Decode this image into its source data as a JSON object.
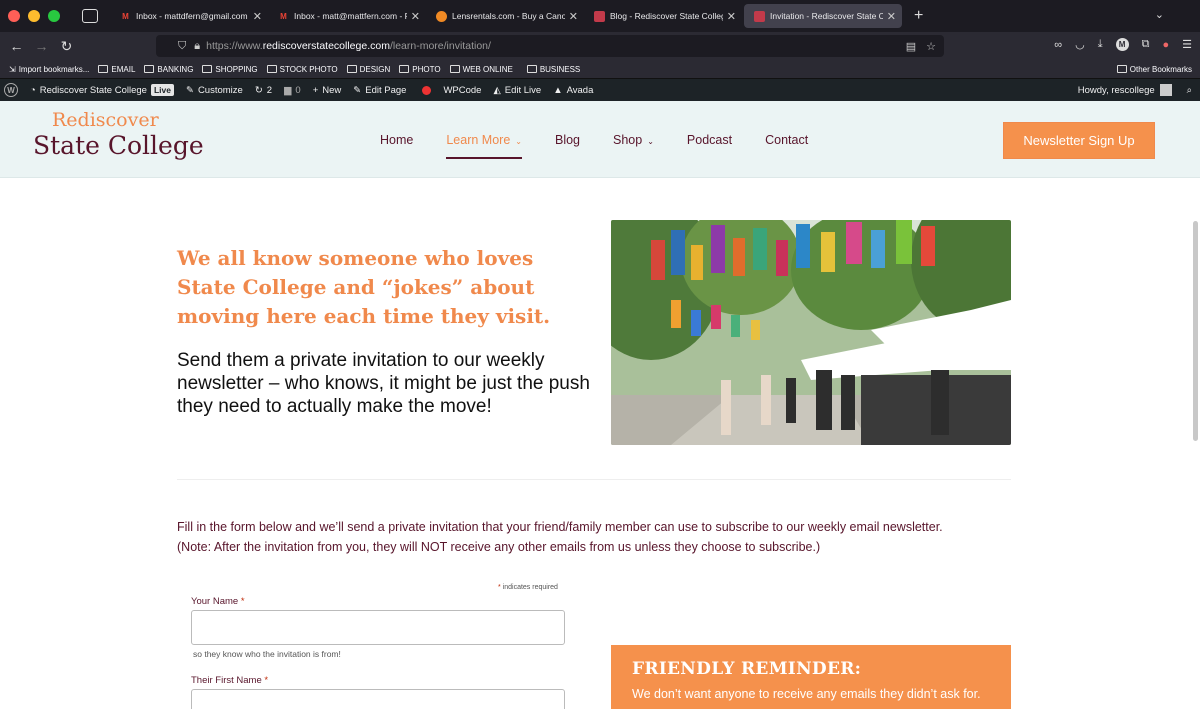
{
  "browser": {
    "tabs": [
      {
        "title": "Inbox - mattdfern@gmail.com -",
        "favicon": "gmail-icon",
        "active": false
      },
      {
        "title": "Inbox - matt@mattfern.com - F",
        "favicon": "gmail-icon",
        "active": false
      },
      {
        "title": "Lensrentals.com - Buy a Canon",
        "favicon": "lensrentals-icon",
        "active": false
      },
      {
        "title": "Blog - Rediscover State College",
        "favicon": "rsc-icon",
        "active": false
      },
      {
        "title": "Invitation - Rediscover State Co",
        "favicon": "rsc-icon",
        "active": true
      }
    ],
    "url_prefix": "https://www.",
    "url_domain": "rediscoverstatecollege.com",
    "url_path": "/learn-more/invitation/",
    "extension_badge": "M",
    "bookmarks": [
      {
        "label": "Import bookmarks..."
      },
      {
        "label": "EMAIL"
      },
      {
        "label": "BANKING"
      },
      {
        "label": "SHOPPING"
      },
      {
        "label": "STOCK PHOTO"
      },
      {
        "label": "DESIGN"
      },
      {
        "label": "PHOTO"
      },
      {
        "label": "WEB ONLINE"
      },
      {
        "label": "BUSINESS"
      }
    ],
    "other_bookmarks": "Other Bookmarks"
  },
  "admin_bar": {
    "site_name": "Rediscover State College",
    "live_badge": "Live",
    "customize": "Customize",
    "updates_count": "2",
    "comments_count": "0",
    "new": "New",
    "edit_page": "Edit Page",
    "wpcode": "WPCode",
    "edit_live": "Edit Live",
    "avada": "Avada",
    "howdy": "Howdy, rescollege"
  },
  "site": {
    "logo_line1": "Rediscover",
    "logo_line2": "State College",
    "menu": [
      {
        "label": "Home",
        "current": false,
        "dropdown": false
      },
      {
        "label": "Learn More",
        "current": true,
        "dropdown": true
      },
      {
        "label": "Blog",
        "current": false,
        "dropdown": false
      },
      {
        "label": "Shop",
        "current": false,
        "dropdown": true
      },
      {
        "label": "Podcast",
        "current": false,
        "dropdown": false
      },
      {
        "label": "Contact",
        "current": false,
        "dropdown": false
      }
    ],
    "newsletter_button": "Newsletter Sign Up",
    "headline": "We all know someone who loves State College and “jokes” about moving here each time they visit.",
    "subline": "Send them a private invitation to our weekly newsletter – who knows, it might be just the push they need to actually make the move!",
    "fill_part1": "Fill in the form below and ",
    "fill_part2": "we’ll send a private invitation that your friend/family member can use to subscribe to our weekly email newsletter.",
    "fill_note": "(Note: After the invitation from you, they will NOT receive any other emails from us unless they choose to subscribe.)",
    "required_mark": "*",
    "required_note": " indicates required",
    "form": {
      "your_name_label": "Your Name",
      "your_name_help": "so they know who the invitation is from!",
      "their_first_name_label": "Their First Name"
    },
    "reminder_title": "FRIENDLY REMINDER:",
    "reminder_text": "We don’t want anyone to receive any emails they didn’t ask for."
  }
}
